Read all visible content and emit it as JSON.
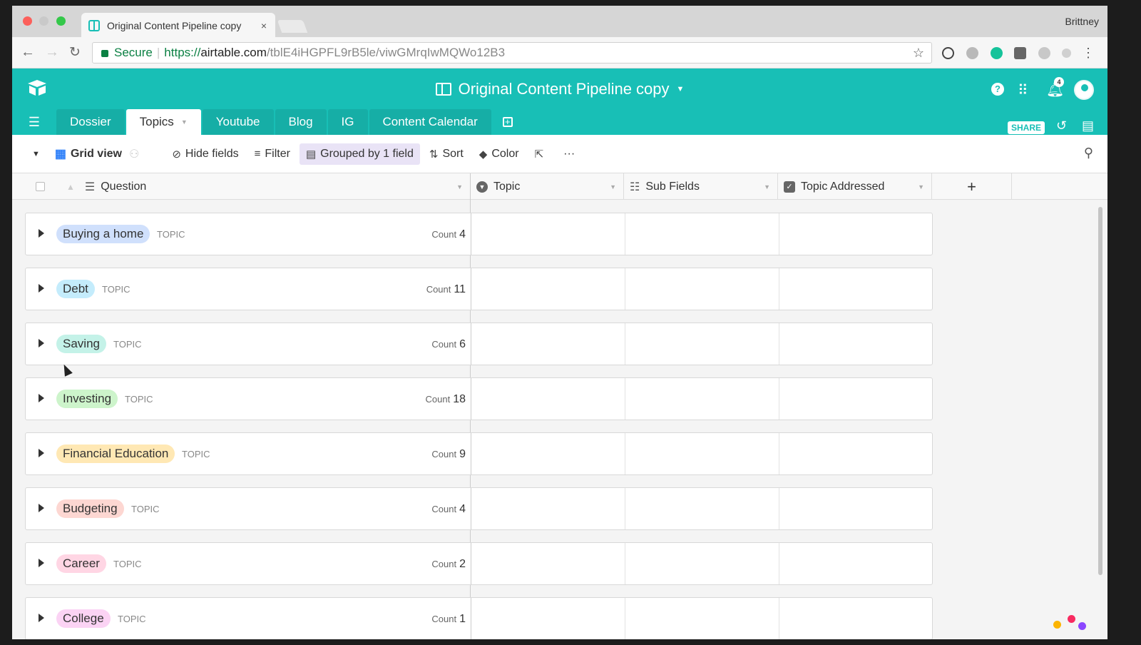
{
  "browser": {
    "tab_title": "Original Content Pipeline copy",
    "tab_close": "×",
    "profile": "Brittney",
    "secure": "Secure",
    "url_scheme": "https://",
    "url_host": "airtable.com",
    "url_path": "/tblE4iHGPFL9rB5le/viwGMrqIwMQWo12B3"
  },
  "app": {
    "base_title": "Original Content Pipeline copy",
    "notif_count": "4",
    "share": "SHARE",
    "tabs": [
      "Dossier",
      "Topics",
      "Youtube",
      "Blog",
      "IG",
      "Content Calendar"
    ]
  },
  "view": {
    "name": "Grid view",
    "hide_fields": "Hide fields",
    "filter": "Filter",
    "grouped": "Grouped by 1 field",
    "sort": "Sort",
    "color": "Color",
    "more": "···"
  },
  "columns": [
    "Question",
    "Topic",
    "Sub Fields",
    "Topic Addressed"
  ],
  "add_column": "+",
  "groups": [
    {
      "name": "Buying a home",
      "label": "TOPIC",
      "count_label": "Count",
      "count": "4",
      "color": "#d0e0fc"
    },
    {
      "name": "Debt",
      "label": "TOPIC",
      "count_label": "Count",
      "count": "11",
      "color": "#c4ecfc"
    },
    {
      "name": "Saving",
      "label": "TOPIC",
      "count_label": "Count",
      "count": "6",
      "color": "#c4f2e8"
    },
    {
      "name": "Investing",
      "label": "TOPIC",
      "count_label": "Count",
      "count": "18",
      "color": "#cdf4cb"
    },
    {
      "name": "Financial Education",
      "label": "TOPIC",
      "count_label": "Count",
      "count": "9",
      "color": "#ffe8b4"
    },
    {
      "name": "Budgeting",
      "label": "TOPIC",
      "count_label": "Count",
      "count": "4",
      "color": "#fdd7d2"
    },
    {
      "name": "Career",
      "label": "TOPIC",
      "count_label": "Count",
      "count": "2",
      "color": "#ffd6e4"
    },
    {
      "name": "College",
      "label": "TOPIC",
      "count_label": "Count",
      "count": "1",
      "color": "#fbd3f4"
    }
  ]
}
